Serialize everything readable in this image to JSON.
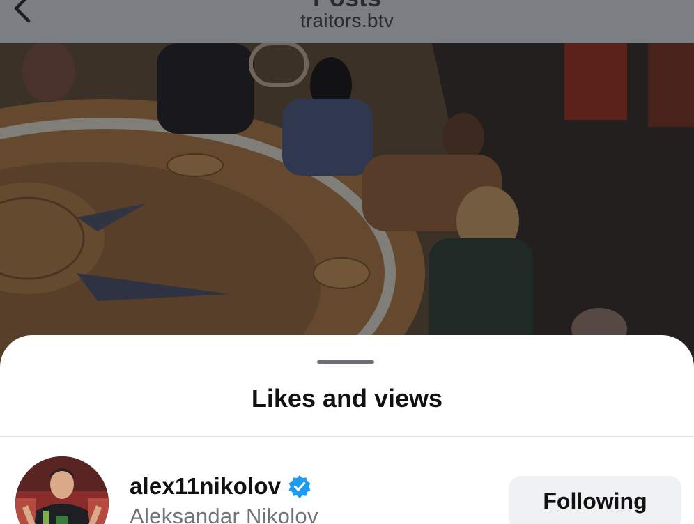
{
  "nav": {
    "title": "Posts",
    "subtitle": "traitors.btv",
    "back_icon": "chevron-left-icon"
  },
  "post": {
    "image": "dimmed-post-photo"
  },
  "sheet": {
    "title": "Likes and views"
  },
  "users": [
    {
      "username": "alex11nikolov",
      "verified": true,
      "full_name": "Aleksandar Nikolov",
      "follow_label": "Following"
    }
  ],
  "colors": {
    "verified_blue": "#1d9bf0",
    "follow_button_bg": "#eff1f3",
    "secondary_text": "#6f7378"
  }
}
